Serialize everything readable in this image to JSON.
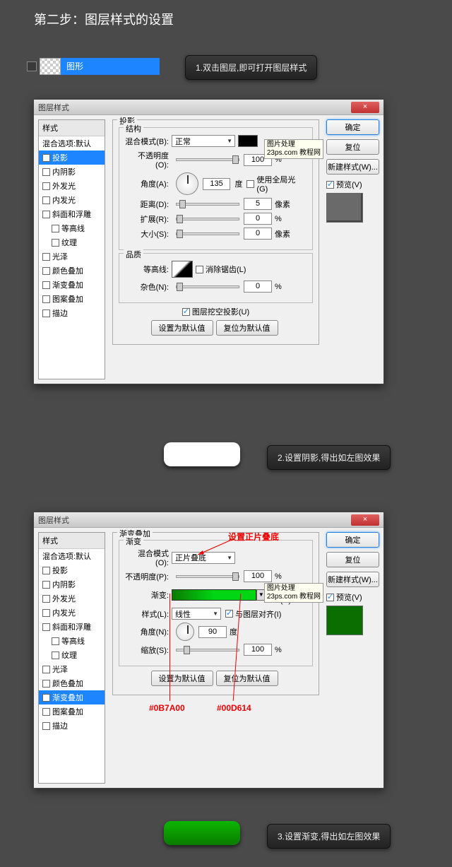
{
  "title": "第二步：图层样式的设置",
  "layer": {
    "name": "图形"
  },
  "callouts": {
    "c1": "1.双击图层,即可打开图层样式",
    "c2": "2.设置阴影,得出如左图效果",
    "c3": "3.设置渐变,得出如左图效果"
  },
  "dialog": {
    "title": "图层样式",
    "close": "×",
    "sidebar": {
      "header": "样式",
      "default": "混合选项:默认",
      "items": [
        {
          "label": "投影",
          "selected": true,
          "checked": true,
          "indent": false
        },
        {
          "label": "内阴影",
          "checked": false,
          "indent": false
        },
        {
          "label": "外发光",
          "checked": false,
          "indent": false
        },
        {
          "label": "内发光",
          "checked": false,
          "indent": false
        },
        {
          "label": "斜面和浮雕",
          "checked": false,
          "indent": false
        },
        {
          "label": "等高线",
          "checked": false,
          "indent": true
        },
        {
          "label": "纹理",
          "checked": false,
          "indent": true
        },
        {
          "label": "光泽",
          "checked": false,
          "indent": false
        },
        {
          "label": "颜色叠加",
          "checked": false,
          "indent": false
        },
        {
          "label": "渐变叠加",
          "checked": false,
          "indent": false
        },
        {
          "label": "图案叠加",
          "checked": false,
          "indent": false
        },
        {
          "label": "描边",
          "checked": false,
          "indent": false
        }
      ],
      "items2": [
        {
          "label": "投影",
          "checked": false,
          "indent": false
        },
        {
          "label": "内阴影",
          "checked": false,
          "indent": false
        },
        {
          "label": "外发光",
          "checked": false,
          "indent": false
        },
        {
          "label": "内发光",
          "checked": false,
          "indent": false
        },
        {
          "label": "斜面和浮雕",
          "checked": false,
          "indent": false
        },
        {
          "label": "等高线",
          "checked": false,
          "indent": true
        },
        {
          "label": "纹理",
          "checked": false,
          "indent": true
        },
        {
          "label": "光泽",
          "checked": false,
          "indent": false
        },
        {
          "label": "颜色叠加",
          "checked": false,
          "indent": false
        },
        {
          "label": "渐变叠加",
          "selected": true,
          "checked": true,
          "indent": false
        },
        {
          "label": "图案叠加",
          "checked": false,
          "indent": false
        },
        {
          "label": "描边",
          "checked": false,
          "indent": false
        }
      ]
    },
    "buttons": {
      "ok": "确定",
      "cancel": "复位",
      "newstyle": "新建样式(W)...",
      "preview": "预览(V)"
    },
    "shadow": {
      "panelTitle": "投影",
      "structTitle": "结构",
      "qualityTitle": "品质",
      "blendLabel": "混合模式(B):",
      "blendValue": "正常",
      "opacityLabel": "不透明度(O):",
      "opacityValue": "100",
      "pct": "%",
      "angleLabel": "角度(A):",
      "angleValue": "135",
      "degree": "度",
      "globalLight": "使用全局光(G)",
      "distLabel": "距离(D):",
      "distValue": "5",
      "px": "像素",
      "spreadLabel": "扩展(R):",
      "spreadValue": "0",
      "sizeLabel": "大小(S):",
      "sizeValue": "0",
      "contourLabel": "等高线:",
      "antialias": "消除锯齿(L)",
      "noiseLabel": "杂色(N):",
      "noiseValue": "0",
      "knockout": "图层挖空投影(U)",
      "setDefault": "设置为默认值",
      "resetDefault": "复位为默认值"
    },
    "gradient": {
      "panelTitle": "渐变叠加",
      "gradTitle": "渐变",
      "blendLabel": "混合模式(O):",
      "blendValue": "正片叠底",
      "opacityLabel": "不透明度(P):",
      "opacityValue": "100",
      "gradLabel": "渐变:",
      "reverse": "反向(R)",
      "styleLabel": "样式(L):",
      "styleValue": "线性",
      "align": "与图层对齐(I)",
      "angleLabel": "角度(N):",
      "angleValue": "90",
      "scaleLabel": "缩放(S):",
      "scaleValue": "100",
      "setDefault": "设置为默认值",
      "resetDefault": "复位为默认值"
    },
    "tooltip": {
      "line1": "图片处理",
      "line2": "23ps.com 教程网"
    }
  },
  "annotations": {
    "modeNote": "设置正片叠底",
    "color1": "#0B7A00",
    "color2": "#00D614"
  }
}
